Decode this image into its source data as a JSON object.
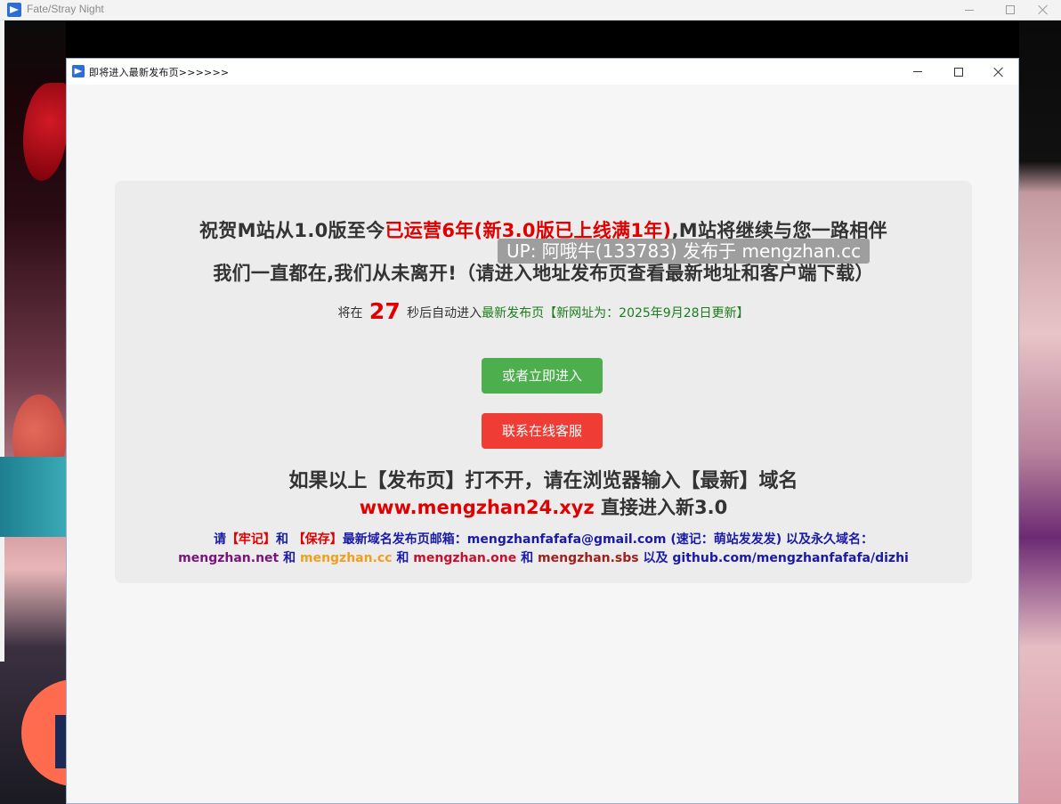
{
  "outer_window": {
    "title": "Fate/Stray Night"
  },
  "dialog": {
    "title": "即将进入最新发布页>>>>>>"
  },
  "headline": {
    "line1_a": "祝贺M站从1.0版至今",
    "line1_b": "已运营6年(新3.0版已上线满1年)",
    "line1_c": ",M站将继续与您一路相伴",
    "line2": "我们一直都在,我们从未离开!（请进入地址发布页查看最新地址和客户端下载）"
  },
  "watermark": "UP: 阿哦牛(133783) 发布于 mengzhan.cc",
  "countdown": {
    "prefix": "将在",
    "seconds": "27",
    "suffix": "秒后自动进入",
    "target": "最新发布页【新网址为：2025年9月28日更新】"
  },
  "buttons": {
    "enter_now": "或者立即进入",
    "contact_support": "联系在线客服"
  },
  "fallback": {
    "line1": "如果以上【发布页】打不开，请在浏览器输入【最新】域名",
    "domain": "www.mengzhan24.xyz",
    "line2_suffix": " 直接进入新3.0"
  },
  "info": {
    "p1": "请",
    "p2": "【牢记】",
    "p3": "和",
    "p4": "【保存】",
    "p5": "最新域名发布页邮箱：mengzhanfafafa@gmail.com (速记：萌站发发发) 以及永久域名：",
    "d1": "mengzhan.net",
    "and1": " 和 ",
    "d2": "mengzhan.cc",
    "and2": " 和 ",
    "d3": "mengzhan.one",
    "and3": " 和 ",
    "d4": "mengzhan.sbs",
    "tail": " 以及 github.com/mengzhanfafafa/dizhi"
  },
  "colors": {
    "accent_red": "#e00000",
    "enter_button": "#4cae4c",
    "support_button": "#ef3d36",
    "link_blue": "#1a1aa8"
  }
}
